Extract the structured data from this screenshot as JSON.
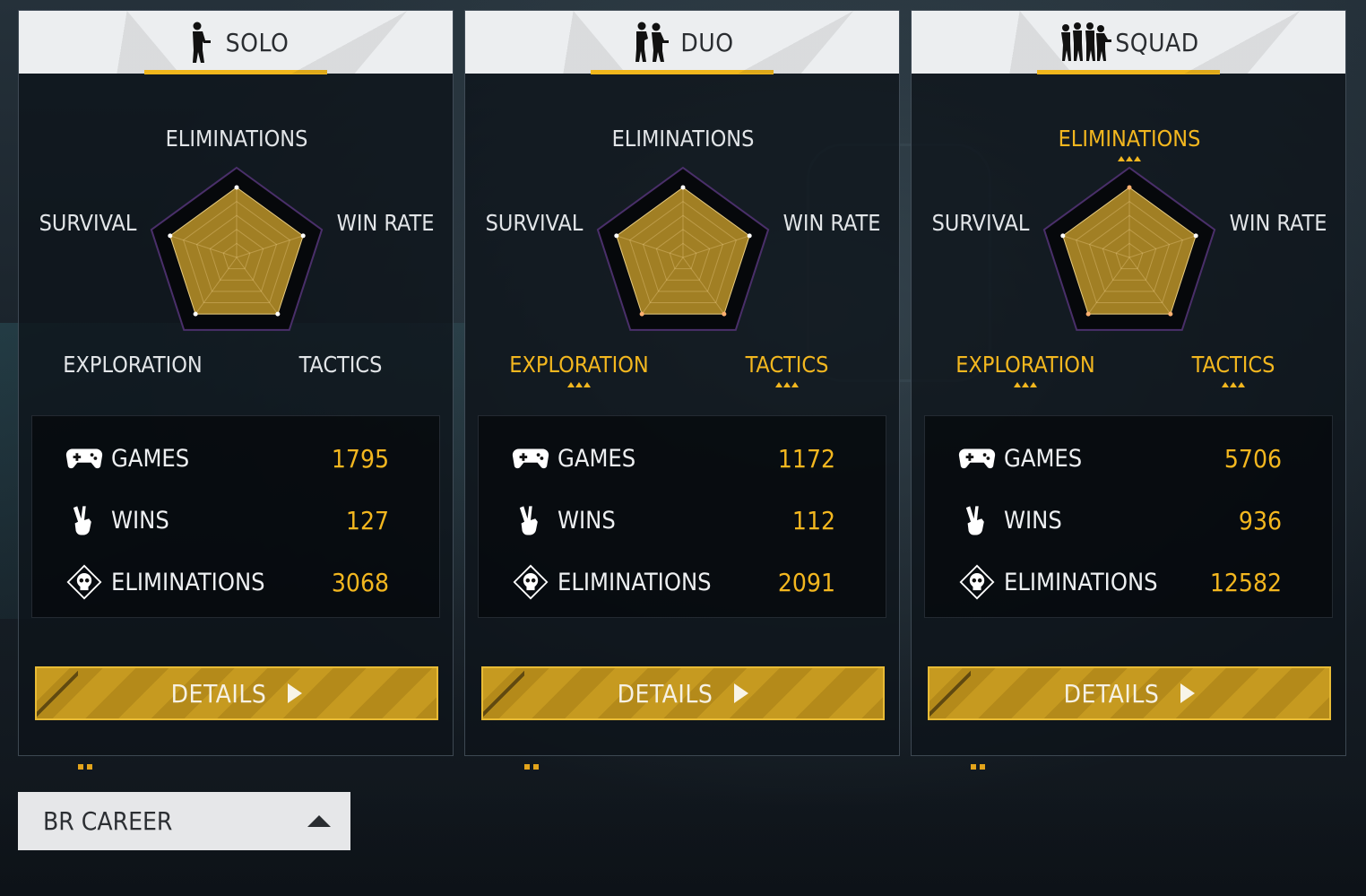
{
  "panels": [
    {
      "mode": "SOLO",
      "icon": "soldier-silhouette-icon",
      "axes": {
        "eliminations": "ELIMINATIONS",
        "win_rate": "WIN RATE",
        "tactics": "TACTICS",
        "exploration": "EXPLORATION",
        "survival": "SURVIVAL"
      },
      "highlighted_axes": [],
      "stats": [
        {
          "icon": "gamepad-icon",
          "label": "GAMES",
          "value": "1795"
        },
        {
          "icon": "victory-hand-icon",
          "label": "WINS",
          "value": "127"
        },
        {
          "icon": "skull-icon",
          "label": "ELIMINATIONS",
          "value": "3068"
        }
      ],
      "details_label": "DETAILS"
    },
    {
      "mode": "DUO",
      "icon": "duo-soldiers-icon",
      "axes": {
        "eliminations": "ELIMINATIONS",
        "win_rate": "WIN RATE",
        "tactics": "TACTICS",
        "exploration": "EXPLORATION",
        "survival": "SURVIVAL"
      },
      "highlighted_axes": [
        "exploration",
        "tactics"
      ],
      "stats": [
        {
          "icon": "gamepad-icon",
          "label": "GAMES",
          "value": "1172"
        },
        {
          "icon": "victory-hand-icon",
          "label": "WINS",
          "value": "112"
        },
        {
          "icon": "skull-icon",
          "label": "ELIMINATIONS",
          "value": "2091"
        }
      ],
      "details_label": "DETAILS"
    },
    {
      "mode": "SQUAD",
      "icon": "squad-soldiers-icon",
      "axes": {
        "eliminations": "ELIMINATIONS",
        "win_rate": "WIN RATE",
        "tactics": "TACTICS",
        "exploration": "EXPLORATION",
        "survival": "SURVIVAL"
      },
      "highlighted_axes": [
        "eliminations",
        "exploration",
        "tactics"
      ],
      "stats": [
        {
          "icon": "gamepad-icon",
          "label": "GAMES",
          "value": "5706"
        },
        {
          "icon": "victory-hand-icon",
          "label": "WINS",
          "value": "936"
        },
        {
          "icon": "skull-icon",
          "label": "ELIMINATIONS",
          "value": "12582"
        }
      ],
      "details_label": "DETAILS"
    }
  ],
  "career": {
    "label": "BR CAREER",
    "icon": "caret-up-icon"
  },
  "colors": {
    "accent": "#f3b71f",
    "radar_fill": "#a17f24",
    "header_bg": "#eceef0"
  }
}
